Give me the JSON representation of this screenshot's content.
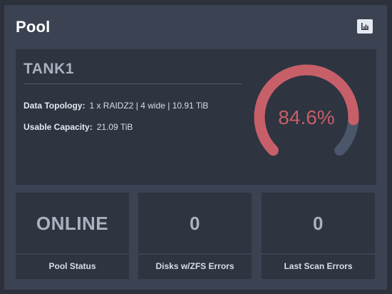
{
  "widget": {
    "title": "Pool",
    "chart_button_icon": "bar-chart-icon"
  },
  "pool": {
    "name": "TANK1",
    "topology_label": "Data Topology:",
    "topology_value": "1 x RAIDZ2 | 4 wide | 10.91 TiB",
    "capacity_label": "Usable Capacity:",
    "capacity_value": "21.09 TiB"
  },
  "gauge": {
    "label": "84.6%",
    "percent": 84.6,
    "color": "#c75f69",
    "track_color": "#4c566a"
  },
  "stats": [
    {
      "value": "ONLINE",
      "label": "Pool Status"
    },
    {
      "value": "0",
      "label": "Disks w/ZFS Errors"
    },
    {
      "value": "0",
      "label": "Last Scan Errors"
    }
  ]
}
